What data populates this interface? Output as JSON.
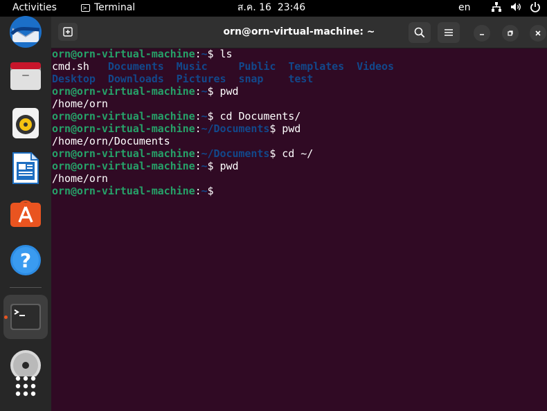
{
  "topbar": {
    "activities": "Activities",
    "app_name": "Terminal",
    "clock_date": "ส.ค. 16",
    "clock_time": "23:46",
    "language": "en"
  },
  "dock": {
    "apps": [
      "thunderbird-icon",
      "files-icon",
      "rhythmbox-icon",
      "libreoffice-writer-icon",
      "ubuntu-software-icon",
      "help-icon",
      "terminal-icon",
      "dvd-drive-icon",
      "show-apps-icon"
    ]
  },
  "window": {
    "title": "orn@orn-virtual-machine: ~"
  },
  "terminal": {
    "prompt_user": "orn@orn-virtual-machine",
    "lines": [
      {
        "type": "prompt",
        "path": "~",
        "cmd": " ls"
      },
      {
        "type": "ls",
        "items": [
          "cmd.sh",
          "Documents",
          "Music",
          "Public",
          "Templates",
          "Videos"
        ]
      },
      {
        "type": "ls2",
        "items": [
          "Desktop",
          "Downloads",
          "Pictures",
          "snap",
          "test"
        ]
      },
      {
        "type": "prompt",
        "path": "~",
        "cmd": " pwd"
      },
      {
        "type": "out",
        "text": "/home/orn"
      },
      {
        "type": "prompt",
        "path": "~",
        "cmd": " cd Documents/"
      },
      {
        "type": "prompt",
        "path": "~/Documents",
        "cmd": " pwd"
      },
      {
        "type": "out",
        "text": "/home/orn/Documents"
      },
      {
        "type": "prompt",
        "path": "~/Documents",
        "cmd": " cd ~/"
      },
      {
        "type": "prompt",
        "path": "~",
        "cmd": " pwd"
      },
      {
        "type": "out",
        "text": "/home/orn"
      },
      {
        "type": "prompt",
        "path": "~",
        "cmd": ""
      }
    ]
  }
}
